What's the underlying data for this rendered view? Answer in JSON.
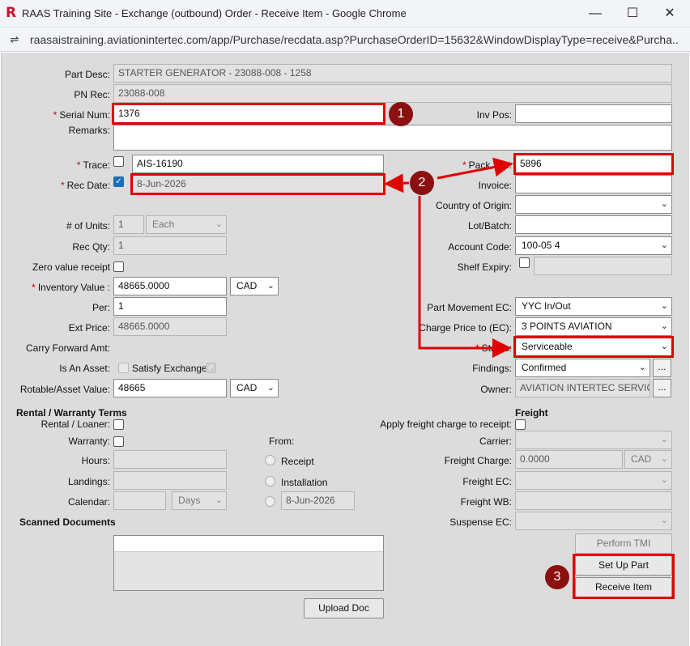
{
  "window": {
    "title": "RAAS Training Site - Exchange (outbound) Order - Receive Item - Google Chrome",
    "logo": "R",
    "url": "raasaistraining.aviationintertec.com/app/Purchase/recdata.asp?PurchaseOrderID=15632&WindowDisplayType=receive&Purcha...",
    "minimize": "—",
    "maximize": "☐",
    "close": "✕",
    "tune_icon": "⇌"
  },
  "required_mark": "*",
  "left": {
    "part_desc_label": "Part Desc:",
    "part_desc_value": "STARTER GENERATOR - 23088-008 - 1258",
    "pn_rec_label": "PN Rec:",
    "pn_rec_value": "23088-008",
    "serial_num_label": "Serial Num:",
    "serial_num_value": "1376",
    "remarks_label": "Remarks:",
    "trace_label": "Trace:",
    "trace_value": "AIS-16190",
    "rec_date_label": "Rec Date:",
    "rec_date_value": "8-Jun-2026",
    "units_label": "# of Units:",
    "units_value": "1",
    "units_uom": "Each",
    "rec_qty_label": "Rec Qty:",
    "rec_qty_value": "1",
    "zero_value_label": "Zero value receipt",
    "inventory_value_label": "Inventory Value :",
    "inventory_value": "48665.0000",
    "inventory_currency": "CAD",
    "per_label": "Per:",
    "per_value": "1",
    "ext_price_label": "Ext Price:",
    "ext_price_value": "48665.0000",
    "carry_forward_label": "Carry Forward Amt:",
    "is_asset_label": "Is An Asset:",
    "satisfy_exchange_label": "Satisfy Exchange:",
    "rotable_label": "Rotable/Asset Value:",
    "rotable_value": "48665",
    "rotable_currency": "CAD"
  },
  "right": {
    "inv_pos_label": "Inv Pos:",
    "pack_slip_label": "Pack Slip:",
    "pack_slip_value": "5896",
    "invoice_label": "Invoice:",
    "country_label": "Country of Origin:",
    "lot_label": "Lot/Batch:",
    "account_label": "Account Code:",
    "account_value": "100-05 4",
    "shelf_label": "Shelf Expiry:",
    "part_movement_label": "Part Movement EC:",
    "part_movement_value": "YYC In/Out",
    "charge_price_label": "Charge Price to (EC):",
    "charge_price_value": "3 POINTS AVIATION",
    "status_label": "Status:",
    "status_value": "Serviceable",
    "findings_label": "Findings:",
    "findings_value": "Confirmed",
    "owner_label": "Owner:",
    "owner_value": "AVIATION INTERTEC SERVICES",
    "dots": "..."
  },
  "rental": {
    "heading": "Rental / Warranty Terms",
    "rental_loaner_label": "Rental / Loaner:",
    "warranty_label": "Warranty:",
    "hours_label": "Hours:",
    "landings_label": "Landings:",
    "calendar_label": "Calendar:",
    "calendar_unit": "Days",
    "from_label": "From:",
    "receipt_label": "Receipt",
    "installation_label": "Installation",
    "from_date": "8-Jun-2026"
  },
  "freight": {
    "heading": "Freight",
    "apply_label": "Apply freight charge to receipt:",
    "carrier_label": "Carrier:",
    "charge_label": "Freight Charge:",
    "charge_value": "0.0000",
    "charge_currency": "CAD",
    "ec_label": "Freight EC:",
    "wb_label": "Freight WB:",
    "suspense_label": "Suspense EC:"
  },
  "documents": {
    "heading": "Scanned Documents",
    "upload_label": "Upload Doc"
  },
  "actions": {
    "perform_tmi": "Perform TMI",
    "set_up_part": "Set Up Part",
    "receive_item": "Receive Item"
  },
  "callouts": {
    "one": "1",
    "two": "2",
    "three": "3",
    "color": "#e00000",
    "badge_color": "#8b1010"
  }
}
